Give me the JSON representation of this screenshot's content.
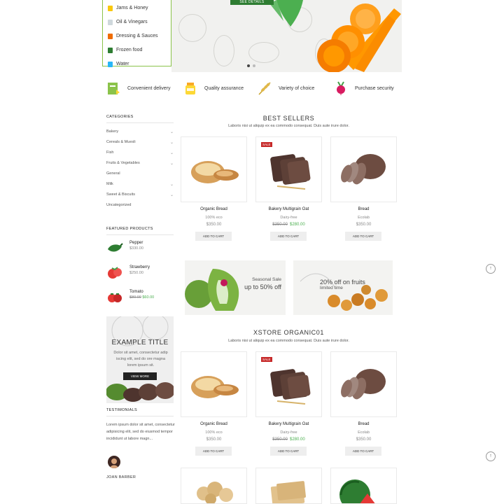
{
  "dropdown": {
    "items": [
      {
        "label": "Jams & Honey",
        "color": "#f9c80e"
      },
      {
        "label": "Oil & Vinegars",
        "color": "#cfd8dc"
      },
      {
        "label": "Dressing & Sauces",
        "color": "#ef6c00"
      },
      {
        "label": "Frozen food",
        "color": "#2e7d32"
      },
      {
        "label": "Water",
        "color": "#29b6f6"
      }
    ]
  },
  "hero": {
    "button": "SEE DETAILS"
  },
  "features": [
    {
      "label": "Convenient delivery",
      "icon": "delivery-box-icon"
    },
    {
      "label": "Quality assurance",
      "icon": "honey-jar-icon"
    },
    {
      "label": "Variety of choice",
      "icon": "wheat-icon"
    },
    {
      "label": "Purchase security",
      "icon": "radish-icon"
    }
  ],
  "sidebar": {
    "categories_title": "CATEGORIES",
    "categories": [
      {
        "label": "Bakery",
        "expandable": true
      },
      {
        "label": "Cereals & Muesli",
        "expandable": true
      },
      {
        "label": "Fish",
        "expandable": true
      },
      {
        "label": "Fruits & Vegetables",
        "expandable": true
      },
      {
        "label": "General",
        "expandable": false
      },
      {
        "label": "Milk",
        "expandable": true
      },
      {
        "label": "Sweet & Biscuits",
        "expandable": true
      },
      {
        "label": "Uncategorized",
        "expandable": false
      }
    ],
    "featured_title": "FEATURED PRODUCTS",
    "featured": [
      {
        "name": "Pepper",
        "price": "$330.00"
      },
      {
        "name": "Strawberry",
        "price": "$250.00"
      },
      {
        "name": "Tomato",
        "old_price": "$80.00",
        "price": "$60.00"
      }
    ],
    "banner": {
      "title": "EXAMPLE TITLE",
      "text": "Dolor sit amet, consectetur adip iscing elit, sed do ore magna lorem ipsum sit.",
      "button": "VIEW MORE"
    },
    "testimonials_title": "TESTIMONIALS",
    "testimonial_text": "Lorem ipsum dolor sit amet, consectetur adipisicing elit, sed do eiusmod tempor incididunt ut labore magn...",
    "testimonial_name": "JOAN BARBER"
  },
  "best_sellers": {
    "title": "BEST SELLERS",
    "subtitle": "Laboris nisi ut aliquip ex ea commodo consequat. Duis aute irure dolor.",
    "products": [
      {
        "name": "Organic Bread",
        "sub": "100% eco",
        "price": "$350.00",
        "old_price": "",
        "sale": false,
        "button": "ADD TO CART"
      },
      {
        "name": "Bakery Multigrain Oat",
        "sub": "Dairy-free",
        "price": "$280.00",
        "old_price": "$350.00",
        "sale": true,
        "sale_label": "SALE",
        "button": "ADD TO CART"
      },
      {
        "name": "Bread",
        "sub": "Ecolab",
        "price": "$350.00",
        "old_price": "",
        "sale": false,
        "button": "ADD TO CART"
      }
    ]
  },
  "promos": [
    {
      "small": "Seasonal Sale",
      "big": "up to 50% off"
    },
    {
      "small": "",
      "big": "20% off on fruits",
      "extra": "limited time"
    }
  ],
  "xstore": {
    "title": "XSTORE ORGANIC01",
    "subtitle": "Laboris nisi ut aliquip ex ea commodo consequat. Duis aute irure dolor.",
    "products": [
      {
        "name": "Organic Bread",
        "sub": "100% eco",
        "price": "$350.00",
        "old_price": "",
        "sale": false,
        "button": "ADD TO CART"
      },
      {
        "name": "Bakery Multigrain Oat",
        "sub": "Dairy-free",
        "price": "$280.00",
        "old_price": "$350.00",
        "sale": true,
        "sale_label": "SALE",
        "button": "ADD TO CART"
      },
      {
        "name": "Bread",
        "sub": "Ecolab",
        "price": "$350.00",
        "old_price": "",
        "sale": false,
        "button": "ADD TO CART"
      }
    ]
  },
  "scroll_icon": "↑"
}
